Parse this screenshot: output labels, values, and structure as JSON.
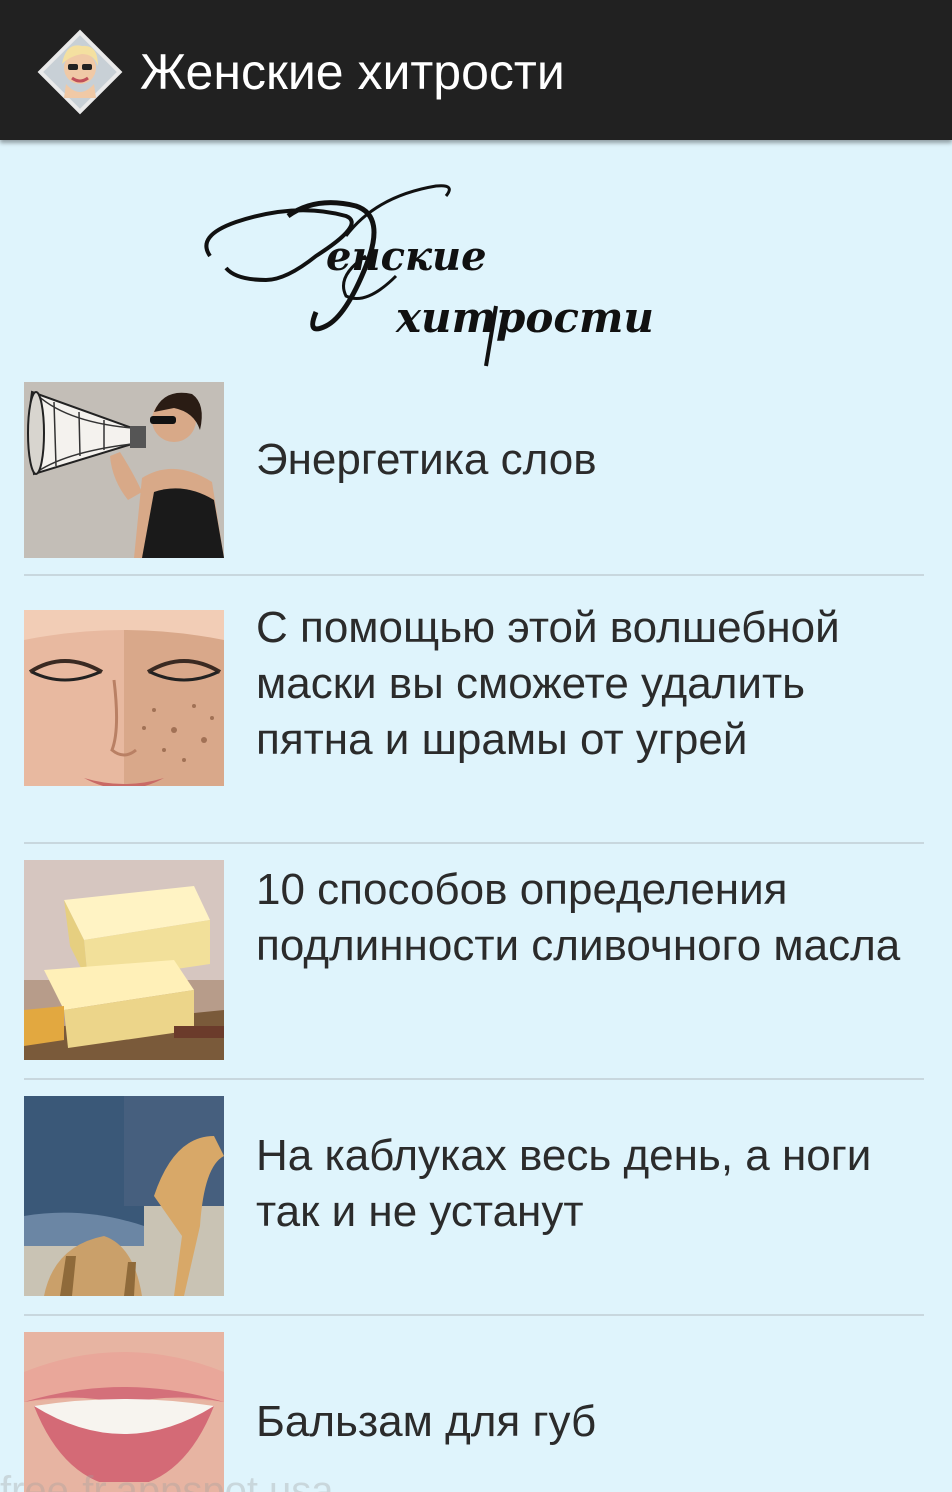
{
  "app": {
    "title": "Женские хитрости",
    "icon": "woman-portrait-icon"
  },
  "logo": {
    "text": "Женские хитрости",
    "line1": "енские",
    "line2": "хитрости"
  },
  "articles": [
    {
      "title": "Энергетика слов",
      "image": "woman-megaphone"
    },
    {
      "title": "С помощью этой волшебной маски вы сможете удалить пятна и шрамы от угрей",
      "image": "face-skin"
    },
    {
      "title": "10  способов определения подлинности сливочного масла",
      "image": "butter"
    },
    {
      "title": "На каблуках весь день, а ноги так и не устанут",
      "image": "high-heels"
    },
    {
      "title": "Бальзам для губ",
      "image": "lips"
    }
  ],
  "watermark": "free-fr.appspot.usa"
}
